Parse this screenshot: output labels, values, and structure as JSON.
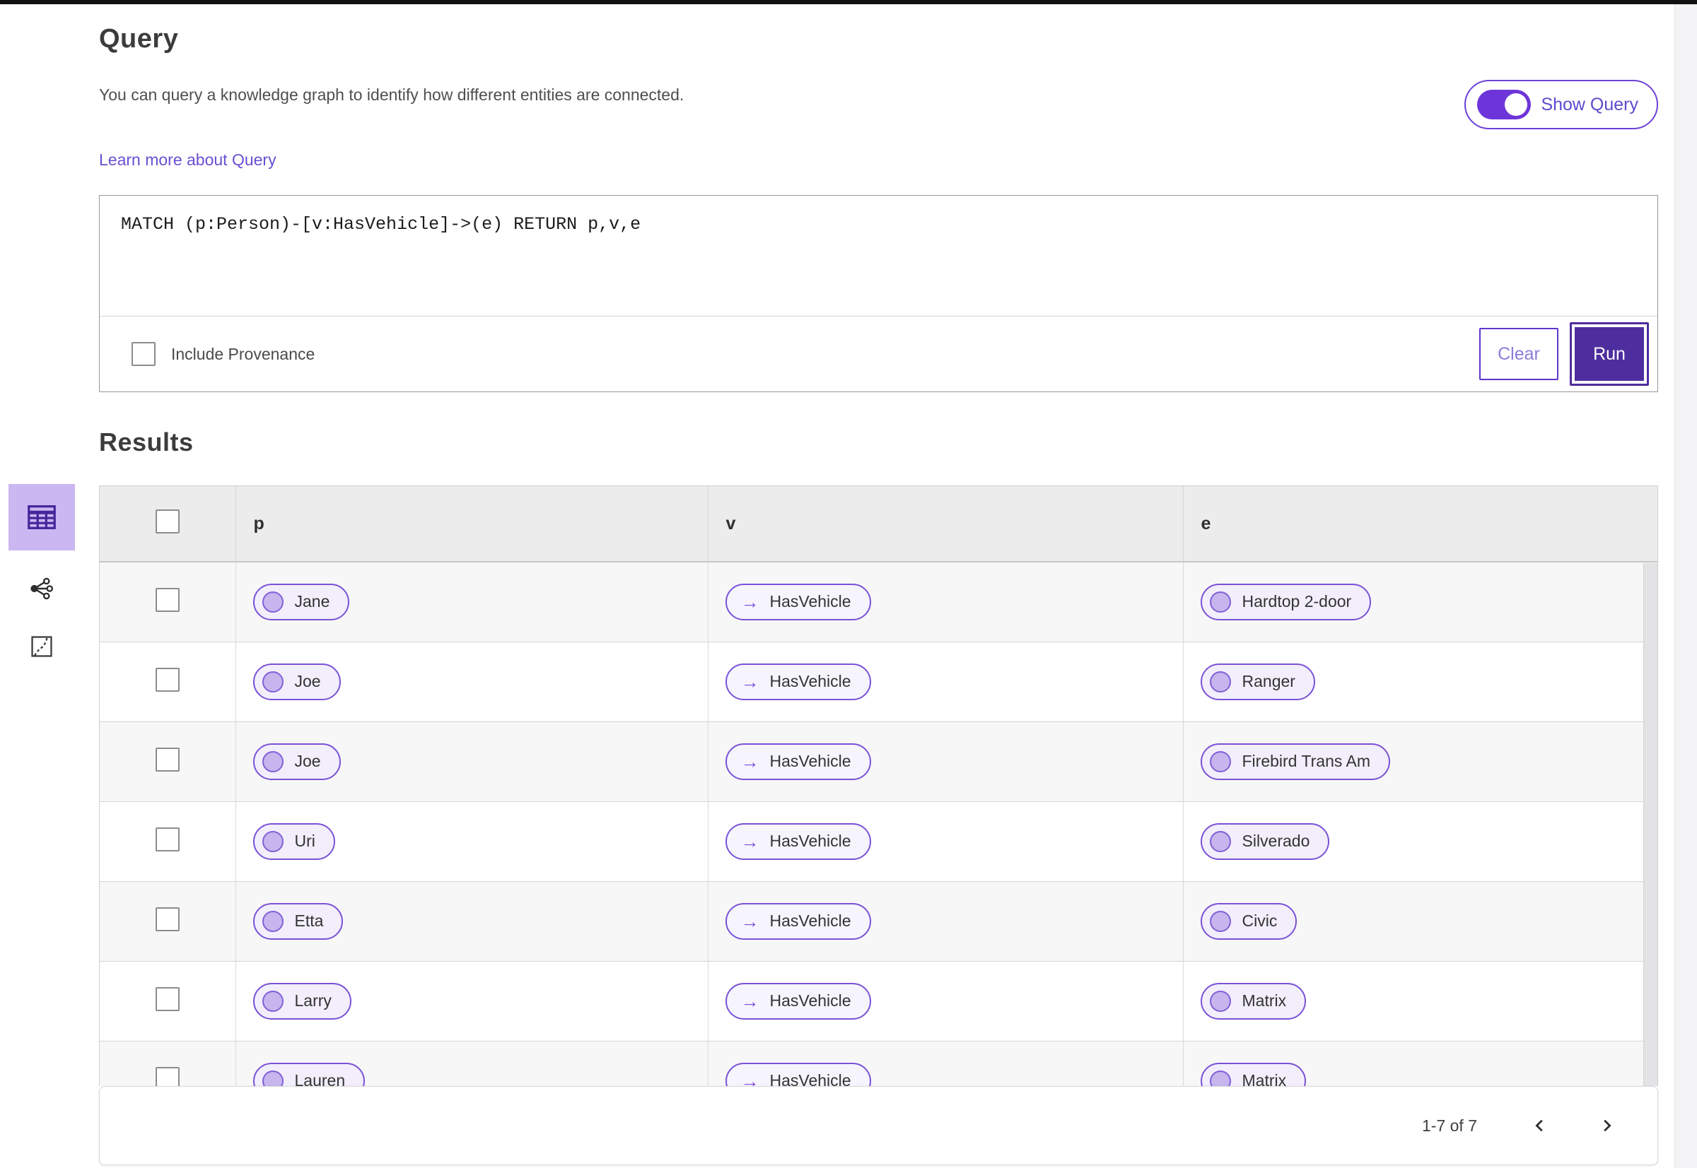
{
  "query_section": {
    "title": "Query",
    "description": "You can query a knowledge graph to identify how different entities are connected.",
    "learn_more_label": "Learn more about Query",
    "show_query_toggle": {
      "label": "Show Query",
      "state": "on"
    },
    "query_text": "MATCH (p:Person)-[v:HasVehicle]->(e) RETURN p,v,e",
    "include_provenance_label": "Include Provenance",
    "include_provenance_checked": false,
    "clear_label": "Clear",
    "run_label": "Run"
  },
  "results_section": {
    "title": "Results",
    "view_switcher": [
      {
        "id": "table-view",
        "icon": "table-icon",
        "selected": true
      },
      {
        "id": "graph-view",
        "icon": "share-nodes-icon",
        "selected": false
      },
      {
        "id": "map-view",
        "icon": "route-map-icon",
        "selected": false
      }
    ],
    "table": {
      "columns": [
        "p",
        "v",
        "e"
      ],
      "rows": [
        {
          "p": "Jane",
          "v": "HasVehicle",
          "e": "Hardtop 2-door"
        },
        {
          "p": "Joe",
          "v": "HasVehicle",
          "e": "Ranger"
        },
        {
          "p": "Joe",
          "v": "HasVehicle",
          "e": "Firebird Trans Am"
        },
        {
          "p": "Uri",
          "v": "HasVehicle",
          "e": "Silverado"
        },
        {
          "p": "Etta",
          "v": "HasVehicle",
          "e": "Civic"
        },
        {
          "p": "Larry",
          "v": "HasVehicle",
          "e": "Matrix"
        },
        {
          "p": "Lauren",
          "v": "HasVehicle",
          "e": "Matrix"
        }
      ]
    },
    "pagination": {
      "range_label": "1-7 of 7",
      "prev_icon": "chevron-left-icon",
      "next_icon": "chevron-right-icon"
    }
  },
  "icons": {
    "edge_arrow_glyph": "→"
  },
  "colors": {
    "accent_purple": "#6d3fd4",
    "run_button_fill": "#4e2e9e",
    "selected_view_bg": "#cbb7f2",
    "pill_border": "#7a52d6",
    "node_pill_bg": "#f2eefb",
    "node_circle_fill": "#c7b5ed",
    "edge_pill_bg": "#f6f4fd",
    "link_color": "#6a4fd1",
    "header_row_bg": "#ececec",
    "alt_row_bg": "#f7f7f7"
  }
}
